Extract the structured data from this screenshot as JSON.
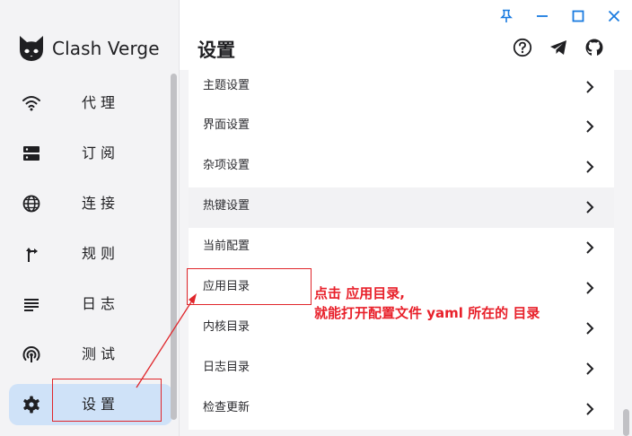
{
  "app": {
    "name": "Clash Verge"
  },
  "sidebar": {
    "items": [
      {
        "label": "代理",
        "icon": "wifi-icon"
      },
      {
        "label": "订阅",
        "icon": "dns-icon"
      },
      {
        "label": "连接",
        "icon": "globe-icon"
      },
      {
        "label": "规则",
        "icon": "fork-arrow-icon"
      },
      {
        "label": "日志",
        "icon": "list-lines-icon"
      },
      {
        "label": "测试",
        "icon": "radar-icon"
      },
      {
        "label": "设置",
        "icon": "gear-icon",
        "active": true
      }
    ]
  },
  "header": {
    "title": "设置",
    "actions": [
      "help-icon",
      "telegram-icon",
      "github-icon"
    ]
  },
  "window_controls": [
    "pin-icon",
    "minimize-icon",
    "maximize-icon",
    "close-icon"
  ],
  "settings": {
    "rows": [
      "主题设置",
      "界面设置",
      "杂项设置",
      "热键设置",
      "当前配置",
      "应用目录",
      "内核目录",
      "日志目录",
      "检查更新"
    ]
  },
  "annotation": {
    "line1": "点击 应用目录,",
    "line2": "就能打开配置文件 yaml 所在的 目录",
    "color": "#e8202a"
  },
  "colors": {
    "accent_active": "#cfe2f8",
    "sidebar_bg": "#f3f3f5",
    "annotation_red": "#e0262b"
  }
}
